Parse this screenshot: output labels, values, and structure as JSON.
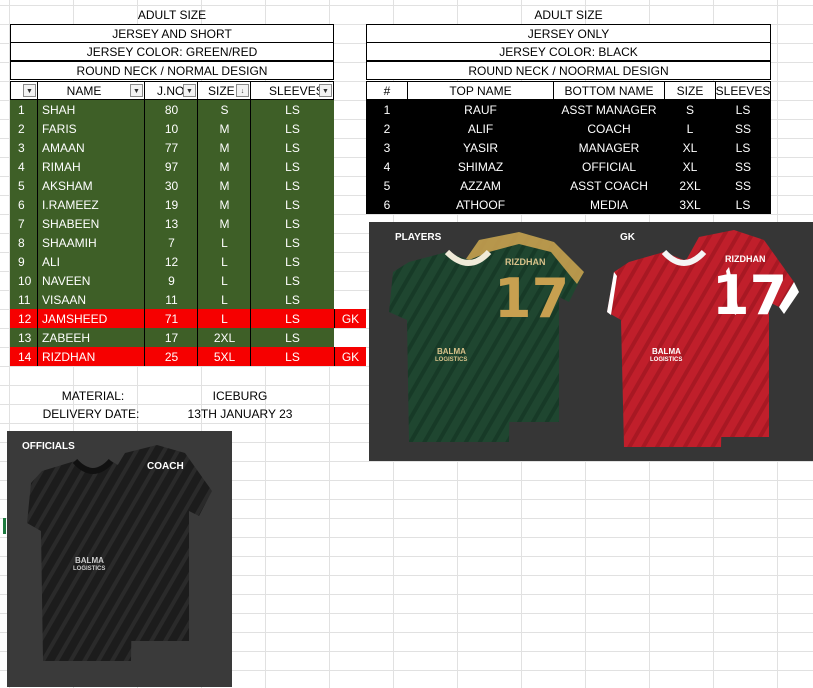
{
  "left_block": {
    "title": "ADULT SIZE",
    "subtitle": "JERSEY AND SHORT",
    "color": "JERSEY COLOR: GREEN/RED",
    "design": "ROUND NECK / NORMAL DESIGN",
    "columns": [
      "",
      "NAME",
      "J.NO",
      "SIZE",
      "SLEEVES"
    ],
    "rows": [
      {
        "num": "1",
        "name": "SHAH",
        "jno": "80",
        "size": "S",
        "sleeve": "LS",
        "extra": "",
        "style": "green"
      },
      {
        "num": "2",
        "name": "FARIS",
        "jno": "10",
        "size": "M",
        "sleeve": "LS",
        "extra": "",
        "style": "green"
      },
      {
        "num": "3",
        "name": "AMAAN",
        "jno": "77",
        "size": "M",
        "sleeve": "LS",
        "extra": "",
        "style": "green"
      },
      {
        "num": "4",
        "name": "RIMAH",
        "jno": "97",
        "size": "M",
        "sleeve": "LS",
        "extra": "",
        "style": "green"
      },
      {
        "num": "5",
        "name": "AKSHAM",
        "jno": "30",
        "size": "M",
        "sleeve": "LS",
        "extra": "",
        "style": "green"
      },
      {
        "num": "6",
        "name": "I.RAMEEZ",
        "jno": "19",
        "size": "M",
        "sleeve": "LS",
        "extra": "",
        "style": "green"
      },
      {
        "num": "7",
        "name": "SHABEEN",
        "jno": "13",
        "size": "M",
        "sleeve": "LS",
        "extra": "",
        "style": "green"
      },
      {
        "num": "8",
        "name": "SHAAMIH",
        "jno": "7",
        "size": "L",
        "sleeve": "LS",
        "extra": "",
        "style": "green"
      },
      {
        "num": "9",
        "name": "ALI",
        "jno": "12",
        "size": "L",
        "sleeve": "LS",
        "extra": "",
        "style": "green"
      },
      {
        "num": "10",
        "name": "NAVEEN",
        "jno": "9",
        "size": "L",
        "sleeve": "LS",
        "extra": "",
        "style": "green"
      },
      {
        "num": "11",
        "name": "VISAAN",
        "jno": "11",
        "size": "L",
        "sleeve": "LS",
        "extra": "",
        "style": "green"
      },
      {
        "num": "12",
        "name": "JAMSHEED",
        "jno": "71",
        "size": "L",
        "sleeve": "LS",
        "extra": "GK",
        "style": "red"
      },
      {
        "num": "13",
        "name": "ZABEEH",
        "jno": "17",
        "size": "2XL",
        "sleeve": "LS",
        "extra": "",
        "style": "green"
      },
      {
        "num": "14",
        "name": "RIZDHAN",
        "jno": "25",
        "size": "5XL",
        "sleeve": "LS",
        "extra": "GK",
        "style": "red"
      }
    ],
    "material_label": "MATERIAL:",
    "material_value": "ICEBURG",
    "delivery_label": "DELIVERY DATE:",
    "delivery_value": "13TH JANUARY 23"
  },
  "right_block": {
    "title": "ADULT SIZE",
    "subtitle": "JERSEY ONLY",
    "color": "JERSEY COLOR: BLACK",
    "design": "ROUND NECK / NOORMAL DESIGN",
    "columns": [
      "#",
      "TOP NAME",
      "BOTTOM NAME",
      "SIZE",
      "SLEEVES"
    ],
    "rows": [
      {
        "num": "1",
        "top": "RAUF",
        "bottom": "ASST MANAGER",
        "size": "S",
        "sleeve": "LS"
      },
      {
        "num": "2",
        "top": "ALIF",
        "bottom": "COACH",
        "size": "L",
        "sleeve": "SS"
      },
      {
        "num": "3",
        "top": "YASIR",
        "bottom": "MANAGER",
        "size": "XL",
        "sleeve": "LS"
      },
      {
        "num": "4",
        "top": "SHIMAZ",
        "bottom": "OFFICIAL",
        "size": "XL",
        "sleeve": "SS"
      },
      {
        "num": "5",
        "top": "AZZAM",
        "bottom": "ASST COACH",
        "size": "2XL",
        "sleeve": "SS"
      },
      {
        "num": "6",
        "top": "ATHOOF",
        "bottom": "MEDIA",
        "size": "3XL",
        "sleeve": "LS"
      }
    ]
  },
  "images": {
    "players_label": "PLAYERS",
    "gk_label": "GK",
    "officials_label": "OFFICIALS",
    "player_back_name": "RIZDHAN",
    "player_back_number": "17",
    "coach_back_name": "COACH",
    "sponsor": "BALMA",
    "sponsor_sub": "LOGISTICS"
  },
  "colors": {
    "green_row": "#3e5f27",
    "red_row": "#f60000",
    "black_row": "#000000",
    "player_jersey": "#1f4630",
    "player_trim": "#c8a050",
    "gk_jersey": "#c01f2b",
    "officials_jersey": "#1c1c1c"
  }
}
